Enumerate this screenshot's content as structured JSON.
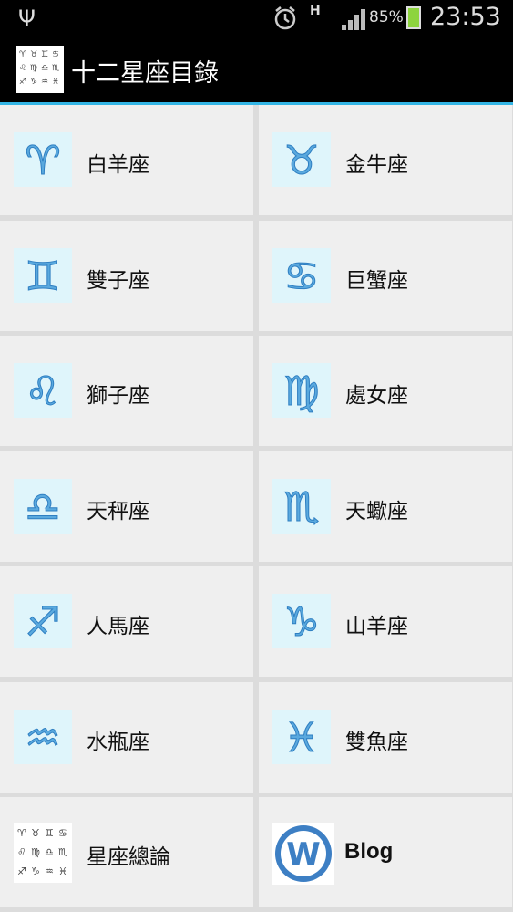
{
  "status_bar": {
    "network_type": "H",
    "battery_percent": "85%",
    "time": "23:53",
    "icons": [
      "usb-icon",
      "alarm-icon",
      "signal-icon",
      "battery-icon"
    ]
  },
  "app": {
    "title": "十二星座目錄",
    "accent_color": "#33b5e5"
  },
  "items": [
    {
      "label": "白羊座",
      "icon": "aries-icon",
      "glyph": "♈"
    },
    {
      "label": "金牛座",
      "icon": "taurus-icon",
      "glyph": "♉"
    },
    {
      "label": "雙子座",
      "icon": "gemini-icon",
      "glyph": "♊"
    },
    {
      "label": "巨蟹座",
      "icon": "cancer-icon",
      "glyph": "♋"
    },
    {
      "label": "獅子座",
      "icon": "leo-icon",
      "glyph": "♌"
    },
    {
      "label": "處女座",
      "icon": "virgo-icon",
      "glyph": "♍"
    },
    {
      "label": "天秤座",
      "icon": "libra-icon",
      "glyph": "♎"
    },
    {
      "label": "天蠍座",
      "icon": "scorpio-icon",
      "glyph": "♏"
    },
    {
      "label": "人馬座",
      "icon": "sagittarius-icon",
      "glyph": "♐"
    },
    {
      "label": "山羊座",
      "icon": "capricorn-icon",
      "glyph": "♑"
    },
    {
      "label": "水瓶座",
      "icon": "aquarius-icon",
      "glyph": "♒"
    },
    {
      "label": "雙魚座",
      "icon": "pisces-icon",
      "glyph": "♓"
    },
    {
      "label": "星座總論",
      "icon": "zodiac-chart-icon"
    },
    {
      "label": "Blog",
      "icon": "wordpress-icon"
    }
  ]
}
